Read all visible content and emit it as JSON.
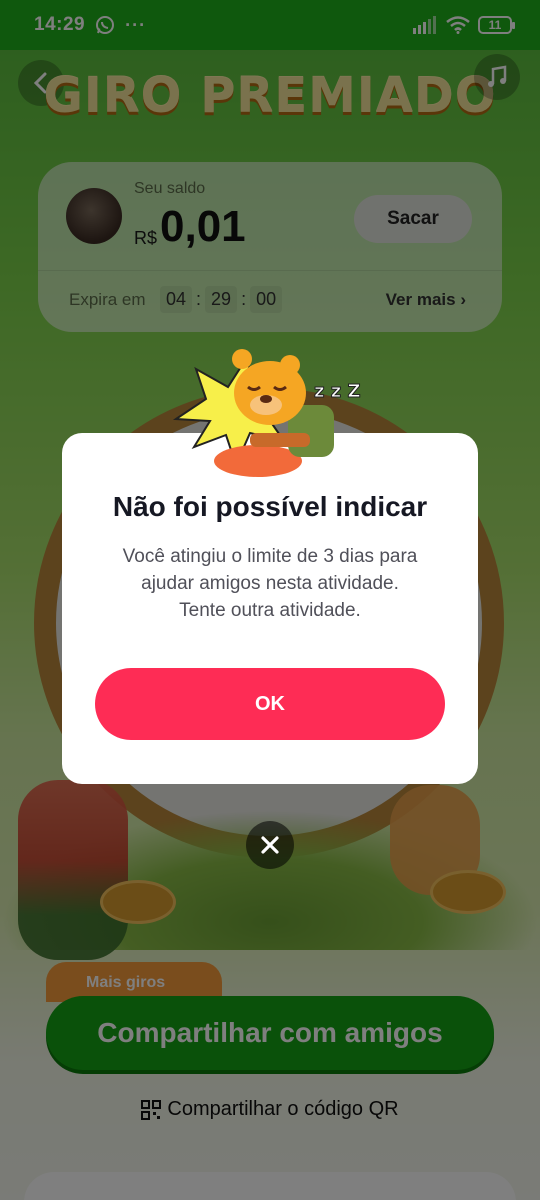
{
  "status_bar": {
    "time": "14:29",
    "dots": "···",
    "battery": "11"
  },
  "page": {
    "title": "GIRO PREMIADO",
    "balance": {
      "label": "Seu saldo",
      "currency": "R$",
      "amount": "0,01",
      "withdraw_label": "Sacar",
      "expire_label": "Expira em",
      "timer": [
        "04",
        "29",
        "00"
      ],
      "timer_sep": ":",
      "see_more": "Ver mais"
    },
    "more_spins": "Mais giros",
    "share_label": "Compartilhar com amigos",
    "qr_label": "Compartilhar o código QR"
  },
  "dialog": {
    "zzz": "z z Z",
    "title": "Não foi possível indicar",
    "message_lines": [
      "Você atingiu o limite de 3 dias para",
      "ajudar amigos nesta atividade.",
      "Tente outra atividade."
    ],
    "ok_label": "OK"
  },
  "colors": {
    "status_bar": "#1fb11a",
    "primary_button": "#fe2c55",
    "share_button": "#14a214",
    "dialog_title": "#161823"
  }
}
